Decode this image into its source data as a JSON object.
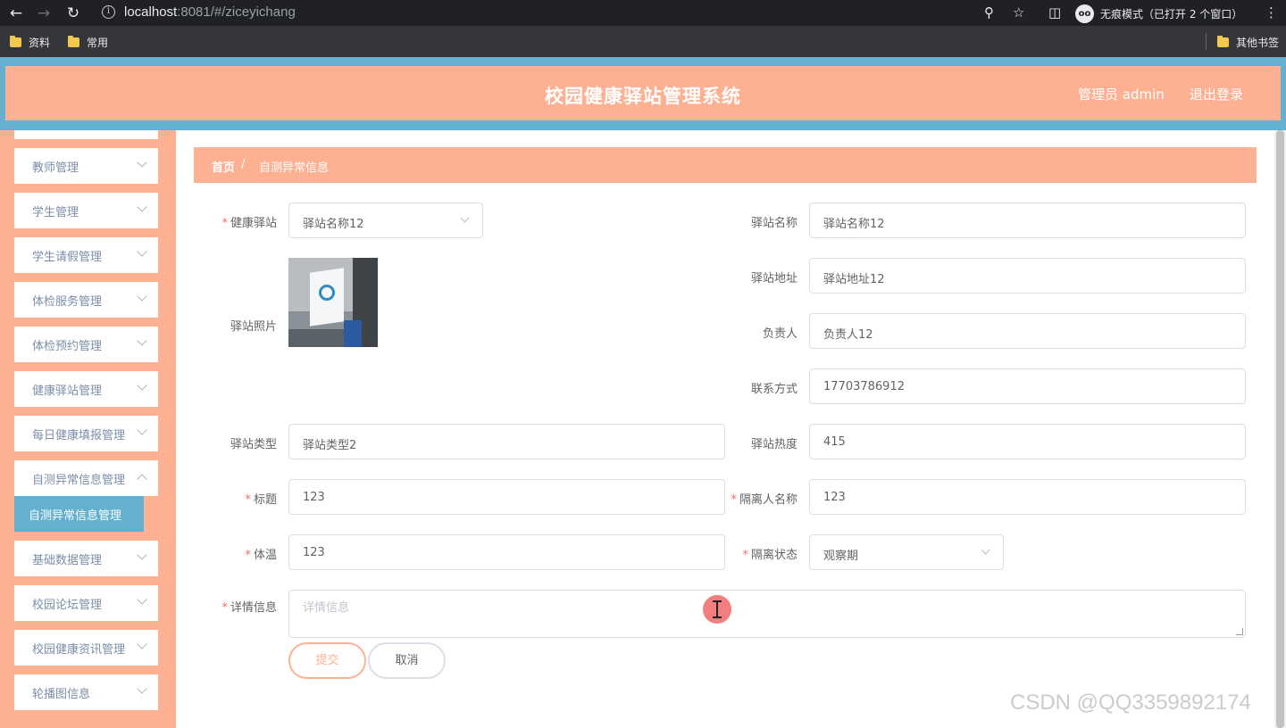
{
  "browser": {
    "url_host": "localhost",
    "url_rest": ":8081/#/ziceyichang",
    "incognito_label": "无痕模式（已打开 2 个窗口）",
    "incognito_badge": "oo",
    "bookmarks": [
      "资料",
      "常用"
    ],
    "other_bookmarks": "其他书签"
  },
  "header": {
    "title": "校园健康驿站管理系统",
    "admin": "管理员 admin",
    "logout": "退出登录"
  },
  "sidebar": {
    "items": [
      "教师管理",
      "学生管理",
      "学生请假管理",
      "体检服务管理",
      "体检预约管理",
      "健康驿站管理",
      "每日健康填报管理",
      "自测异常信息管理"
    ],
    "active_sub": "自测异常信息管理",
    "items_after": [
      "基础数据管理",
      "校园论坛管理",
      "校园健康资讯管理",
      "轮播图信息"
    ]
  },
  "breadcrumb": {
    "home": "首页",
    "separator": "/",
    "current": "自测异常信息"
  },
  "form": {
    "station_label": "健康驿站",
    "station_value": "驿站名称12",
    "photo_label": "驿站照片",
    "station_name_label": "驿站名称",
    "station_name_value": "驿站名称12",
    "station_address_label": "驿站地址",
    "station_address_value": "驿站地址12",
    "manager_label": "负责人",
    "manager_value": "负责人12",
    "contact_label": "联系方式",
    "contact_value": "17703786912",
    "station_type_label": "驿站类型",
    "station_type_value": "驿站类型2",
    "station_heat_label": "驿站热度",
    "station_heat_value": "415",
    "title_label": "标题",
    "title_value": "123",
    "isolation_name_label": "隔离人名称",
    "isolation_name_value": "123",
    "temperature_label": "体温",
    "temperature_value": "123",
    "isolation_status_label": "隔离状态",
    "isolation_status_value": "观察期",
    "detail_label": "详情信息",
    "detail_placeholder": "详情信息",
    "required_mark": "*",
    "submit": "提交",
    "cancel": "取消"
  },
  "watermark": "CSDN @QQ3359892174",
  "colors": {
    "accent": "#feb093",
    "header_border": "#63b1cf",
    "active_menu": "#63b1cf",
    "required": "#f56c6c"
  }
}
